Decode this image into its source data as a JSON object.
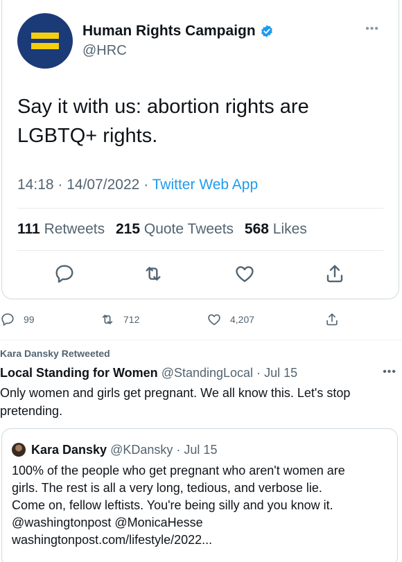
{
  "embedded_tweet": {
    "display_name": "Human Rights Campaign",
    "handle": "@HRC",
    "text": "Say it with us: abortion rights are LGBTQ+ rights.",
    "time": "14:18",
    "date": "14/07/2022",
    "source": "Twitter Web App",
    "stats": {
      "retweets_count": "111",
      "retweets_label": "Retweets",
      "quote_count": "215",
      "quote_label": "Quote Tweets",
      "likes_count": "568",
      "likes_label": "Likes"
    },
    "more_icon": "more-icon"
  },
  "outer_actions": {
    "replies": "99",
    "retweets": "712",
    "likes": "4,207"
  },
  "retweeted_by": "Kara Dansky Retweeted",
  "tweet2": {
    "display_name": "Local Standing for Women",
    "handle": "@StandingLocal",
    "date": "Jul 15",
    "text": "Only women and girls get pregnant. We all know this. Let's stop pretending."
  },
  "quoted": {
    "display_name": "Kara Dansky",
    "handle": "@KDansky",
    "date": "Jul 15",
    "lines": [
      "100% of the people who get pregnant who aren't women are",
      "girls. The rest is all a very long, tedious, and verbose lie.",
      "Come on, fellow leftists. You're being silly and you know it.",
      "@washingtonpost @MonicaHesse",
      "washingtonpost.com/lifestyle/2022..."
    ]
  },
  "colors": {
    "text": "#0f1419",
    "secondary": "#536471",
    "link": "#1d9bf0",
    "border": "#cfd9de",
    "hrc_blue": "#1b3a78",
    "hrc_yellow": "#f5cf0b"
  }
}
